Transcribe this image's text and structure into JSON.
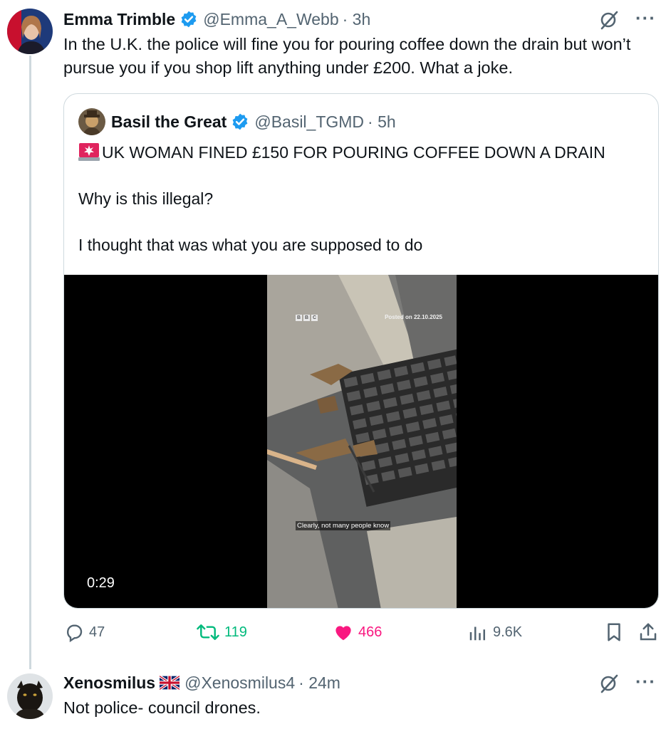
{
  "main_tweet": {
    "name": "Emma Trimble",
    "handle": "@Emma_A_Webb",
    "time": "· 3h",
    "text": "In the U.K. the police will fine you for pouring coffee down the drain but won’t pursue you if you shop lift anything under £200. What a joke.",
    "verified": true
  },
  "quoted_tweet": {
    "name": "Basil the Great",
    "handle": "@Basil_TGMD",
    "time": "· 5h",
    "verified": true,
    "headline": "UK WOMAN FINED £150 FOR POURING COFFEE DOWN A DRAIN",
    "line2": "Why is this illegal?",
    "line3": "I thought that was what you are supposed to do",
    "video": {
      "duration": "0:29",
      "watermark_logo": [
        "B",
        "B",
        "C"
      ],
      "posted_label": "Posted on 22.10.2025",
      "caption": "Clearly, not many people know"
    }
  },
  "actions": {
    "replies": "47",
    "reposts": "119",
    "likes": "466",
    "views": "9.6K"
  },
  "reply_tweet": {
    "name": "Xenosmilus",
    "handle": "@Xenosmilus4",
    "time": "· 24m",
    "text": "Not police- council drones."
  },
  "colors": {
    "verified": "#1d9bf0",
    "repost": "#00ba7c",
    "like": "#f91880",
    "secondary": "#536471"
  },
  "icons": [
    "verified-icon",
    "grok-icon",
    "more-icon",
    "siren-icon",
    "reply-icon",
    "repost-icon",
    "like-icon",
    "views-icon",
    "bookmark-icon",
    "share-icon",
    "uk-flag-icon"
  ]
}
